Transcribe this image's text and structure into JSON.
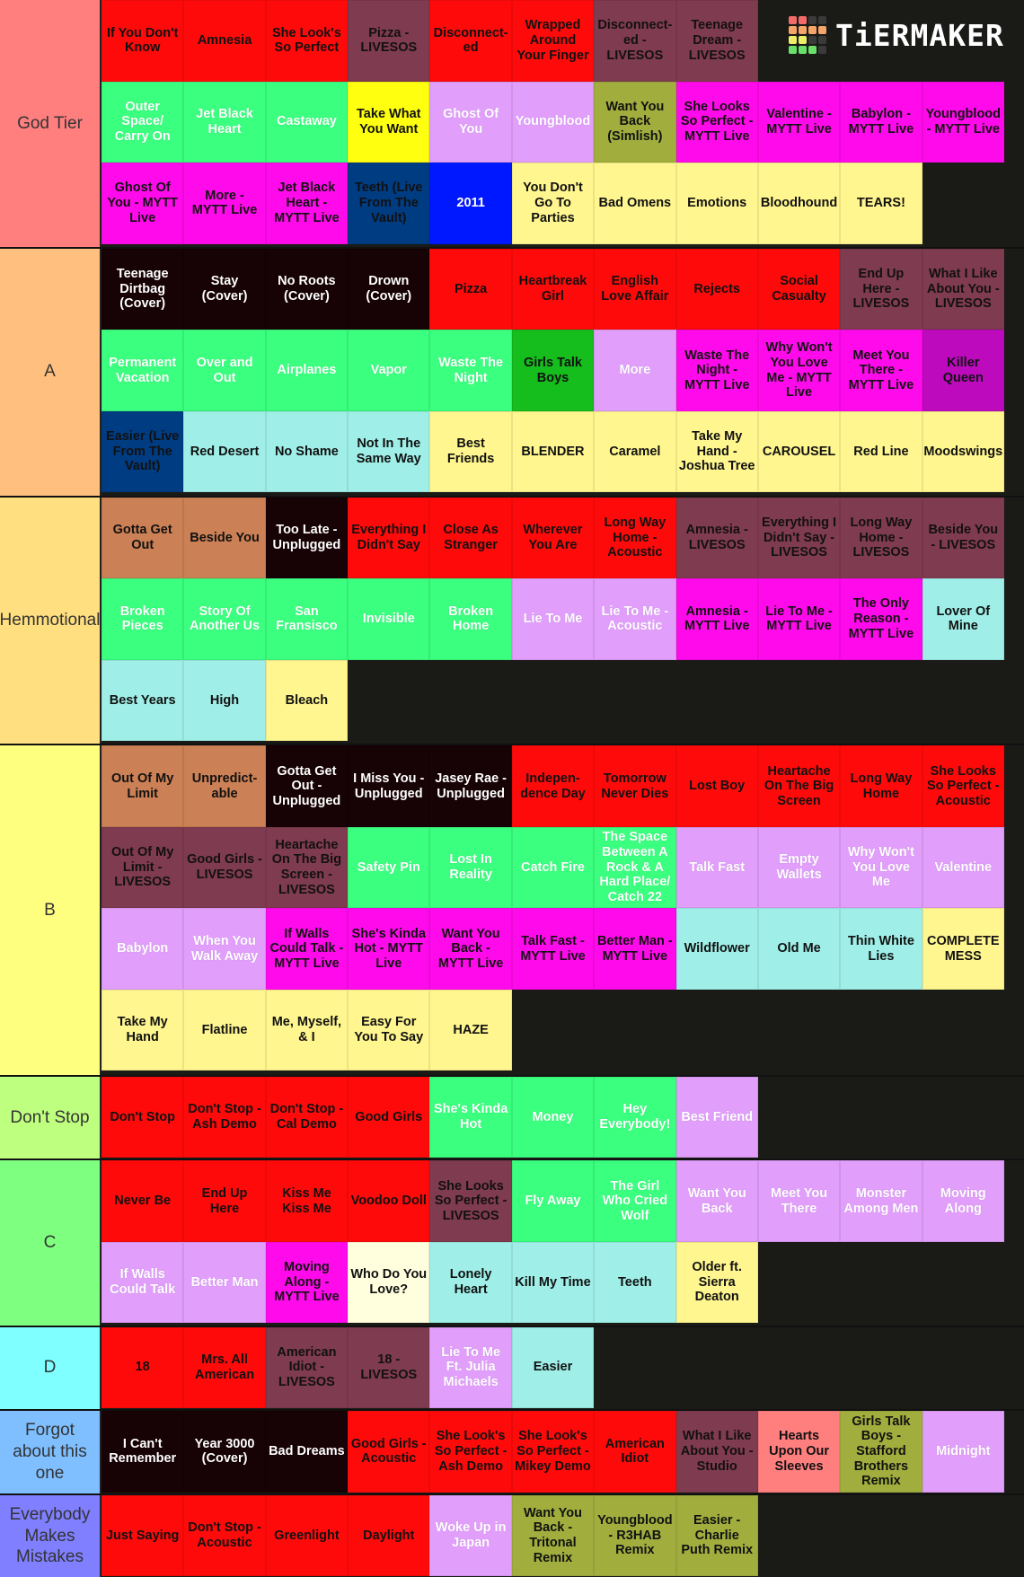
{
  "app": {
    "brand": "TiERMAKER",
    "logo_colors": [
      "#f26b6b",
      "#f26b6b",
      "#3a3a3a",
      "#3a3a3a",
      "#f5a56a",
      "#f5a56a",
      "#f5a56a",
      "#f5a56a",
      "#eded6a",
      "#eded6a",
      "#3a3a3a",
      "#3a3a3a",
      "#6ae06a",
      "#6ae06a",
      "#6ae06a",
      "#3a3a3a"
    ]
  },
  "palette": {
    "red": "#ff0a0a",
    "maroon": "#7f3b4f",
    "mint": "#3bff7f",
    "yellow": "#ffff10",
    "lilac": "#e19ffb",
    "olive": "#a1ae3e",
    "magenta": "#ff0aeb",
    "navy": "#003c82",
    "blue": "#0018ff",
    "cream": "#fff68f",
    "black": "#170205",
    "darkgreen": "#15bd1d",
    "purple": "#bc0abc",
    "aqua": "#9fefe8",
    "tan": "#cb8055",
    "pale": "#ffffde",
    "pink": "#ff7f7f"
  },
  "tiers": [
    {
      "label": "God Tier",
      "color": "#ff7f7f",
      "rows": 3,
      "items": [
        {
          "t": "If You Don't Know",
          "c": "red"
        },
        {
          "t": "Amnesia",
          "c": "red"
        },
        {
          "t": "She Look's So Perfect",
          "c": "red"
        },
        {
          "t": "Pizza - LIVESOS",
          "c": "maroon"
        },
        {
          "t": "Disconnect-ed",
          "c": "red"
        },
        {
          "t": "Wrapped Around Your Finger",
          "c": "red"
        },
        {
          "t": "Disconnect-ed - LIVESOS",
          "c": "maroon"
        },
        {
          "t": "Teenage Dream - LIVESOS",
          "c": "maroon"
        },
        {
          "t": "",
          "c": "none"
        },
        {
          "t": "",
          "c": "none"
        },
        {
          "t": "",
          "c": "none"
        },
        {
          "t": "Outer Space/ Carry On",
          "c": "mint"
        },
        {
          "t": "Jet Black Heart",
          "c": "mint"
        },
        {
          "t": "Castaway",
          "c": "mint"
        },
        {
          "t": "Take What You Want",
          "c": "yellow"
        },
        {
          "t": "Ghost Of You",
          "c": "lilac"
        },
        {
          "t": "Youngblood",
          "c": "lilac"
        },
        {
          "t": "Want You Back (Simlish)",
          "c": "olive"
        },
        {
          "t": "She Looks So Perfect - MYTT Live",
          "c": "magenta"
        },
        {
          "t": "Valentine - MYTT Live",
          "c": "magenta"
        },
        {
          "t": "Babylon - MYTT Live",
          "c": "magenta"
        },
        {
          "t": "Youngblood - MYTT Live",
          "c": "magenta"
        },
        {
          "t": "Ghost Of You - MYTT Live",
          "c": "magenta"
        },
        {
          "t": "More - MYTT Live",
          "c": "magenta"
        },
        {
          "t": "Jet Black Heart - MYTT Live",
          "c": "magenta"
        },
        {
          "t": "Teeth (Live From The Vault)",
          "c": "navy"
        },
        {
          "t": "2011",
          "c": "blue"
        },
        {
          "t": "You Don't Go To Parties",
          "c": "cream"
        },
        {
          "t": "Bad Omens",
          "c": "cream"
        },
        {
          "t": "Emotions",
          "c": "cream"
        },
        {
          "t": "Bloodhound",
          "c": "cream"
        },
        {
          "t": "TEARS!",
          "c": "cream"
        }
      ]
    },
    {
      "label": "A",
      "color": "#ffbf7f",
      "rows": 3,
      "items": [
        {
          "t": "Teenage Dirtbag (Cover)",
          "c": "black"
        },
        {
          "t": "Stay (Cover)",
          "c": "black"
        },
        {
          "t": "No Roots (Cover)",
          "c": "black"
        },
        {
          "t": "Drown (Cover)",
          "c": "black"
        },
        {
          "t": "Pizza",
          "c": "red"
        },
        {
          "t": "Heartbreak Girl",
          "c": "red"
        },
        {
          "t": "English Love Affair",
          "c": "red"
        },
        {
          "t": "Rejects",
          "c": "red"
        },
        {
          "t": "Social Casualty",
          "c": "red"
        },
        {
          "t": "End Up Here - LIVESOS",
          "c": "maroon"
        },
        {
          "t": "What I Like About You - LIVESOS",
          "c": "maroon"
        },
        {
          "t": "Permanent Vacation",
          "c": "mint"
        },
        {
          "t": "Over and Out",
          "c": "mint"
        },
        {
          "t": "Airplanes",
          "c": "mint"
        },
        {
          "t": "Vapor",
          "c": "mint"
        },
        {
          "t": "Waste The Night",
          "c": "mint"
        },
        {
          "t": "Girls Talk Boys",
          "c": "darkgreen"
        },
        {
          "t": "More",
          "c": "lilac"
        },
        {
          "t": "Waste The Night - MYTT Live",
          "c": "magenta"
        },
        {
          "t": "Why Won't You Love Me - MYTT Live",
          "c": "magenta"
        },
        {
          "t": "Meet You There - MYTT Live",
          "c": "magenta"
        },
        {
          "t": "Killer Queen",
          "c": "purple"
        },
        {
          "t": "Easier (Live From The Vault)",
          "c": "navy"
        },
        {
          "t": "Red Desert",
          "c": "aqua"
        },
        {
          "t": "No Shame",
          "c": "aqua"
        },
        {
          "t": "Not In The Same Way",
          "c": "aqua"
        },
        {
          "t": "Best Friends",
          "c": "cream"
        },
        {
          "t": "BLENDER",
          "c": "cream"
        },
        {
          "t": "Caramel",
          "c": "cream"
        },
        {
          "t": "Take My Hand - Joshua Tree",
          "c": "cream"
        },
        {
          "t": "CAROUSEL",
          "c": "cream"
        },
        {
          "t": "Red Line",
          "c": "cream"
        },
        {
          "t": "Moodswings",
          "c": "cream"
        }
      ]
    },
    {
      "label": "Hemmotional",
      "color": "#ffdf7f",
      "rows": 3,
      "items": [
        {
          "t": "Gotta Get Out",
          "c": "tan"
        },
        {
          "t": "Beside You",
          "c": "tan"
        },
        {
          "t": "Too Late - Unplugged",
          "c": "black"
        },
        {
          "t": "Everything I Didn't Say",
          "c": "red"
        },
        {
          "t": "Close As Stranger",
          "c": "red"
        },
        {
          "t": "Wherever You Are",
          "c": "red"
        },
        {
          "t": "Long Way Home - Acoustic",
          "c": "red"
        },
        {
          "t": "Amnesia - LIVESOS",
          "c": "maroon"
        },
        {
          "t": "Everything I Didn't Say - LIVESOS",
          "c": "maroon"
        },
        {
          "t": "Long Way Home - LIVESOS",
          "c": "maroon"
        },
        {
          "t": "Beside You - LIVESOS",
          "c": "maroon"
        },
        {
          "t": "Broken Pieces",
          "c": "mint"
        },
        {
          "t": "Story Of Another Us",
          "c": "mint"
        },
        {
          "t": "San Fransisco",
          "c": "mint"
        },
        {
          "t": "Invisible",
          "c": "mint"
        },
        {
          "t": "Broken Home",
          "c": "mint"
        },
        {
          "t": "Lie To Me",
          "c": "lilac"
        },
        {
          "t": "Lie To Me - Acoustic",
          "c": "lilac"
        },
        {
          "t": "Amnesia - MYTT Live",
          "c": "magenta"
        },
        {
          "t": "Lie To Me - MYTT Live",
          "c": "magenta"
        },
        {
          "t": "The Only Reason - MYTT Live",
          "c": "magenta"
        },
        {
          "t": "Lover Of Mine",
          "c": "aqua"
        },
        {
          "t": "Best Years",
          "c": "aqua"
        },
        {
          "t": "High",
          "c": "aqua"
        },
        {
          "t": "Bleach",
          "c": "cream"
        }
      ]
    },
    {
      "label": "B",
      "color": "#ffff7f",
      "rows": 4,
      "items": [
        {
          "t": "Out Of My Limit",
          "c": "tan"
        },
        {
          "t": "Unpredict-able",
          "c": "tan"
        },
        {
          "t": "Gotta Get Out - Unplugged",
          "c": "black"
        },
        {
          "t": "I Miss You - Unplugged",
          "c": "black"
        },
        {
          "t": "Jasey Rae - Unplugged",
          "c": "black"
        },
        {
          "t": "Indepen-dence Day",
          "c": "red"
        },
        {
          "t": "Tomorrow Never Dies",
          "c": "red"
        },
        {
          "t": "Lost Boy",
          "c": "red"
        },
        {
          "t": "Heartache On The Big Screen",
          "c": "red"
        },
        {
          "t": "Long Way Home",
          "c": "red"
        },
        {
          "t": "She Looks So Perfect - Acoustic",
          "c": "red"
        },
        {
          "t": "Out Of My Limit - LIVESOS",
          "c": "maroon"
        },
        {
          "t": "Good Girls - LIVESOS",
          "c": "maroon"
        },
        {
          "t": "Heartache On The Big Screen - LIVESOS",
          "c": "maroon"
        },
        {
          "t": "Safety Pin",
          "c": "mint"
        },
        {
          "t": "Lost In Reality",
          "c": "mint"
        },
        {
          "t": "Catch Fire",
          "c": "mint"
        },
        {
          "t": "The Space Between A Rock & A Hard Place/ Catch 22",
          "c": "mint"
        },
        {
          "t": "Talk Fast",
          "c": "lilac"
        },
        {
          "t": "Empty Wallets",
          "c": "lilac"
        },
        {
          "t": "Why Won't You Love Me",
          "c": "lilac"
        },
        {
          "t": "Valentine",
          "c": "lilac"
        },
        {
          "t": "Babylon",
          "c": "lilac"
        },
        {
          "t": "When You Walk Away",
          "c": "lilac"
        },
        {
          "t": "If Walls Could Talk - MYTT Live",
          "c": "magenta"
        },
        {
          "t": "She's Kinda Hot - MYTT Live",
          "c": "magenta"
        },
        {
          "t": "Want You Back - MYTT Live",
          "c": "magenta"
        },
        {
          "t": "Talk Fast - MYTT Live",
          "c": "magenta"
        },
        {
          "t": "Better Man - MYTT Live",
          "c": "magenta"
        },
        {
          "t": "Wildflower",
          "c": "aqua"
        },
        {
          "t": "Old Me",
          "c": "aqua"
        },
        {
          "t": "Thin White Lies",
          "c": "aqua"
        },
        {
          "t": "COMPLETE MESS",
          "c": "cream"
        },
        {
          "t": "Take My Hand",
          "c": "cream"
        },
        {
          "t": "Flatline",
          "c": "cream"
        },
        {
          "t": "Me, Myself, & I",
          "c": "cream"
        },
        {
          "t": "Easy For You To Say",
          "c": "cream"
        },
        {
          "t": "HAZE",
          "c": "cream"
        }
      ]
    },
    {
      "label": "Don't Stop",
      "color": "#bfff7f",
      "rows": 1,
      "items": [
        {
          "t": "Don't Stop",
          "c": "red"
        },
        {
          "t": "Don't Stop - Ash Demo",
          "c": "red"
        },
        {
          "t": "Don't Stop - Cal Demo",
          "c": "red"
        },
        {
          "t": "Good Girls",
          "c": "red"
        },
        {
          "t": "She's Kinda Hot",
          "c": "mint"
        },
        {
          "t": "Money",
          "c": "mint"
        },
        {
          "t": "Hey Everybody!",
          "c": "mint"
        },
        {
          "t": "Best Friend",
          "c": "lilac"
        }
      ]
    },
    {
      "label": "C",
      "color": "#7fff7f",
      "rows": 2,
      "items": [
        {
          "t": "Never Be",
          "c": "red"
        },
        {
          "t": "End Up Here",
          "c": "red"
        },
        {
          "t": "Kiss Me Kiss Me",
          "c": "red"
        },
        {
          "t": "Voodoo Doll",
          "c": "red"
        },
        {
          "t": "She Looks So Perfect - LIVESOS",
          "c": "maroon"
        },
        {
          "t": "Fly Away",
          "c": "mint"
        },
        {
          "t": "The Girl Who Cried Wolf",
          "c": "mint"
        },
        {
          "t": "Want You Back",
          "c": "lilac"
        },
        {
          "t": "Meet You There",
          "c": "lilac"
        },
        {
          "t": "Monster Among Men",
          "c": "lilac"
        },
        {
          "t": "Moving Along",
          "c": "lilac"
        },
        {
          "t": "If Walls Could Talk",
          "c": "lilac"
        },
        {
          "t": "Better Man",
          "c": "lilac"
        },
        {
          "t": "Moving Along - MYTT Live",
          "c": "magenta"
        },
        {
          "t": "Who Do You Love?",
          "c": "pale"
        },
        {
          "t": "Lonely Heart",
          "c": "aqua"
        },
        {
          "t": "Kill My Time",
          "c": "aqua"
        },
        {
          "t": "Teeth",
          "c": "aqua"
        },
        {
          "t": "Older ft. Sierra Deaton",
          "c": "cream"
        }
      ]
    },
    {
      "label": "D",
      "color": "#7fffff",
      "rows": 1,
      "items": [
        {
          "t": "18",
          "c": "red"
        },
        {
          "t": "Mrs. All American",
          "c": "red"
        },
        {
          "t": "American Idiot - LIVESOS",
          "c": "maroon"
        },
        {
          "t": "18 - LIVESOS",
          "c": "maroon"
        },
        {
          "t": "Lie To Me Ft. Julia Michaels",
          "c": "lilac"
        },
        {
          "t": "Easier",
          "c": "aqua"
        }
      ]
    },
    {
      "label": "Forgot about this one",
      "color": "#7fbfff",
      "rows": 1,
      "items": [
        {
          "t": "I Can't Remember",
          "c": "black"
        },
        {
          "t": "Year 3000 (Cover)",
          "c": "black"
        },
        {
          "t": "Bad Dreams",
          "c": "black"
        },
        {
          "t": "Good Girls - Acoustic",
          "c": "red"
        },
        {
          "t": "She Look's So Perfect - Ash Demo",
          "c": "red"
        },
        {
          "t": "She Look's So Perfect - Mikey Demo",
          "c": "red"
        },
        {
          "t": "American Idiot",
          "c": "red"
        },
        {
          "t": "What I Like About You - Studio",
          "c": "maroon"
        },
        {
          "t": "Hearts Upon Our Sleeves",
          "c": "pink"
        },
        {
          "t": "Girls Talk Boys - Stafford Brothers Remix",
          "c": "olive"
        },
        {
          "t": "Midnight",
          "c": "lilac"
        }
      ]
    },
    {
      "label": "Everybody Makes Mistakes",
      "color": "#7f7fff",
      "rows": 1,
      "items": [
        {
          "t": "Just Saying",
          "c": "red"
        },
        {
          "t": "Don't Stop - Acoustic",
          "c": "red"
        },
        {
          "t": "Greenlight",
          "c": "red"
        },
        {
          "t": "Daylight",
          "c": "red"
        },
        {
          "t": "Woke Up in Japan",
          "c": "lilac"
        },
        {
          "t": "Want You Back - Tritonal Remix",
          "c": "olive"
        },
        {
          "t": "Youngblood - R3HAB Remix",
          "c": "olive"
        },
        {
          "t": "Easier - Charlie Puth Remix",
          "c": "olive"
        }
      ]
    }
  ]
}
